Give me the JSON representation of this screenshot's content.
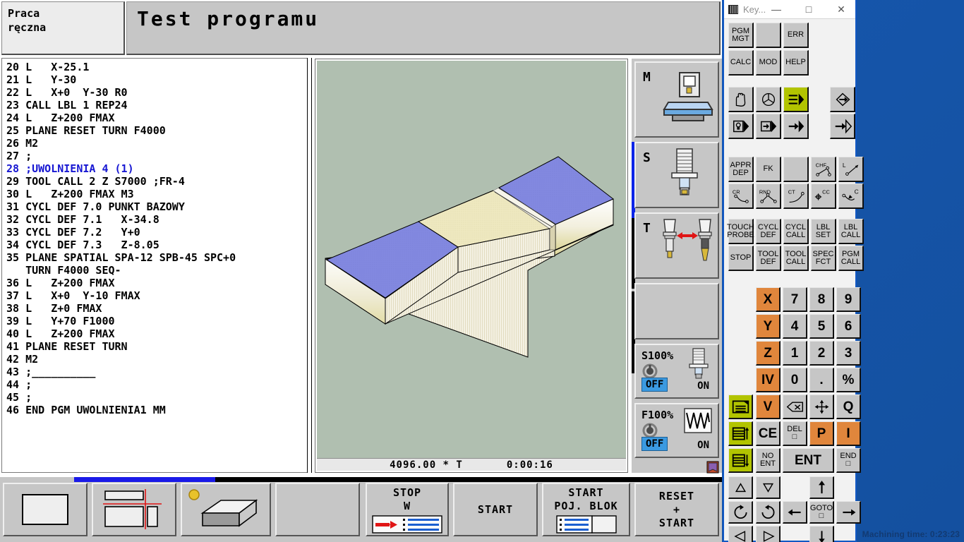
{
  "desktop": {
    "machining_time": "Machining time: 0:23:23"
  },
  "header": {
    "mode_line1": "Praca",
    "mode_line2": "ręczna",
    "title": "Test programu"
  },
  "program": {
    "lines": [
      {
        "text": "20 L   X-25.1",
        "highlight": false
      },
      {
        "text": "21 L   Y-30",
        "highlight": false
      },
      {
        "text": "22 L   X+0  Y-30 R0",
        "highlight": false
      },
      {
        "text": "23 CALL LBL 1 REP24",
        "highlight": false
      },
      {
        "text": "24 L   Z+200 FMAX",
        "highlight": false
      },
      {
        "text": "25 PLANE RESET TURN F4000",
        "highlight": false
      },
      {
        "text": "26 M2",
        "highlight": false
      },
      {
        "text": "27 ;",
        "highlight": false
      },
      {
        "text": "28 ;UWOLNIENIA 4 (1)",
        "highlight": true
      },
      {
        "text": "29 TOOL CALL 2 Z S7000 ;FR-4",
        "highlight": false
      },
      {
        "text": "30 L   Z+200 FMAX M3",
        "highlight": false
      },
      {
        "text": "31 CYCL DEF 7.0 PUNKT BAZOWY",
        "highlight": false
      },
      {
        "text": "32 CYCL DEF 7.1   X-34.8",
        "highlight": false
      },
      {
        "text": "33 CYCL DEF 7.2   Y+0",
        "highlight": false
      },
      {
        "text": "34 CYCL DEF 7.3   Z-8.05",
        "highlight": false
      },
      {
        "text": "35 PLANE SPATIAL SPA-12 SPB-45 SPC+0",
        "highlight": false
      },
      {
        "text": "   TURN F4000 SEQ-",
        "highlight": false
      },
      {
        "text": "36 L   Z+200 FMAX",
        "highlight": false
      },
      {
        "text": "37 L   X+0  Y-10 FMAX",
        "highlight": false
      },
      {
        "text": "38 L   Z+0 FMAX",
        "highlight": false
      },
      {
        "text": "39 L   Y+70 F1000",
        "highlight": false
      },
      {
        "text": "40 L   Z+200 FMAX",
        "highlight": false
      },
      {
        "text": "41 PLANE RESET TURN",
        "highlight": false
      },
      {
        "text": "42 M2",
        "highlight": false
      },
      {
        "text": "43 ;__________",
        "highlight": false
      },
      {
        "text": "44 ;",
        "highlight": false
      },
      {
        "text": "45 ;",
        "highlight": false
      },
      {
        "text": "46 END PGM UWOLNIENIA1 MM",
        "highlight": false
      }
    ]
  },
  "graphics": {
    "status_value": "4096.00 * T",
    "status_time": "0:00:16",
    "background_color": "#b0bfb0",
    "top_face_color": "#8288e0",
    "raw_face_color": "#eee8c0"
  },
  "status_column": {
    "m_label": "M",
    "s_label": "S",
    "t_label": "T",
    "spindle_override": {
      "label": "S100%",
      "off": "OFF",
      "on": "ON"
    },
    "feed_override": {
      "label": "F100%",
      "off": "OFF",
      "on": "ON"
    }
  },
  "softkeys": [
    {
      "name": "view-single",
      "lines": [],
      "icon": "window-icon"
    },
    {
      "name": "view-three-planes",
      "lines": [],
      "icon": "three-views-icon"
    },
    {
      "name": "view-3d",
      "lines": [],
      "icon": "solid-3d-icon"
    },
    {
      "name": "softkey-empty",
      "lines": [],
      "icon": ""
    },
    {
      "name": "stop-w",
      "lines": [
        "STOP",
        "W"
      ],
      "icon": "stop-at-block-icon"
    },
    {
      "name": "start",
      "lines": [
        "START"
      ],
      "icon": ""
    },
    {
      "name": "start-single-block",
      "lines": [
        "START",
        "POJ. BLOK"
      ],
      "icon": "single-block-icon"
    },
    {
      "name": "reset-start",
      "lines": [
        "RESET",
        "+",
        "START"
      ],
      "icon": ""
    }
  ],
  "keyboard": {
    "window_title": "Key...",
    "minimize": "—",
    "maximize": "□",
    "close": "✕",
    "rows_top": [
      [
        {
          "label": "PGM\nMGT",
          "style": "plain"
        },
        {
          "label": "",
          "style": "plain"
        },
        {
          "label": "ERR",
          "style": "plain"
        }
      ],
      [
        {
          "label": "CALC",
          "style": "plain"
        },
        {
          "label": "MOD",
          "style": "plain"
        },
        {
          "label": "HELP",
          "style": "plain"
        }
      ]
    ],
    "modes_row1": [
      "manual-hand-icon",
      "handwheel-icon",
      "program-run-full-icon",
      "program-edit-icon"
    ],
    "modes_row2": [
      "mdi-icon",
      "test-run-icon",
      "single-block-run-icon",
      "program-input-icon"
    ],
    "path_row1": [
      "APPR\nDEP",
      "FK",
      "",
      "CHF",
      "L"
    ],
    "path_row2": [
      "CR",
      "RND",
      "CT",
      "CC",
      "C"
    ],
    "cycle_row1": [
      "TOUCH\nPROBE",
      "CYCL\nDEF",
      "CYCL\nCALL",
      "LBL\nSET",
      "LBL\nCALL"
    ],
    "cycle_row2": [
      "STOP",
      "TOOL\nDEF",
      "TOOL\nCALL",
      "SPEC\nFCT",
      "PGM\nCALL"
    ],
    "numpad": [
      [
        {
          "l": "X",
          "s": "ax"
        },
        {
          "l": "7",
          "s": "num"
        },
        {
          "l": "8",
          "s": "num"
        },
        {
          "l": "9",
          "s": "num"
        }
      ],
      [
        {
          "l": "Y",
          "s": "ax"
        },
        {
          "l": "4",
          "s": "num"
        },
        {
          "l": "5",
          "s": "num"
        },
        {
          "l": "6",
          "s": "num"
        }
      ],
      [
        {
          "l": "Z",
          "s": "ax"
        },
        {
          "l": "1",
          "s": "num"
        },
        {
          "l": "2",
          "s": "num"
        },
        {
          "l": "3",
          "s": "num"
        }
      ],
      [
        {
          "l": "IV",
          "s": "ax"
        },
        {
          "l": "0",
          "s": "num"
        },
        {
          "l": ".",
          "s": "num"
        },
        {
          "l": "%",
          "s": "num"
        }
      ]
    ],
    "edit_keys": [
      {
        "l": "V",
        "s": "ax"
      },
      {
        "l": "⌫",
        "s": "ico"
      },
      {
        "l": "+",
        "s": "ico"
      },
      {
        "l": "Q",
        "s": "num"
      },
      {
        "l": "CE",
        "s": "num"
      },
      {
        "l": "DEL\n□",
        "s": "plain"
      },
      {
        "l": "P",
        "s": "ax"
      },
      {
        "l": "I",
        "s": "ax"
      },
      {
        "l": "NO\nENT",
        "s": "plain"
      },
      {
        "l": "ENT",
        "s": "num"
      },
      {
        "l": "END\n□",
        "s": "plain"
      }
    ],
    "green_keys": [
      "page-icon",
      "page-up-icon",
      "page-down-icon"
    ],
    "nav_row1": [
      "△",
      "▽",
      "↑"
    ],
    "nav_row2": [
      "↺",
      "↻",
      "←",
      "GOTO\n□",
      "→"
    ],
    "nav_row3": [
      "◁",
      "▷",
      "↓"
    ]
  }
}
